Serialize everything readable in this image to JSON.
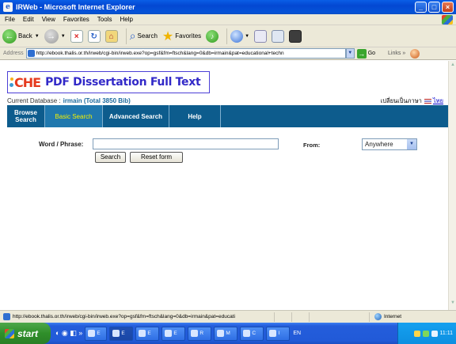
{
  "window": {
    "title": "IRWeb - Microsoft Internet Explorer",
    "minimize_glyph": "_",
    "maximize_glyph": "□",
    "close_glyph": "×"
  },
  "menu": [
    "File",
    "Edit",
    "View",
    "Favorites",
    "Tools",
    "Help"
  ],
  "toolbar": {
    "back_label": "Back",
    "search_label": "Search",
    "favorites_label": "Favorites"
  },
  "address": {
    "label": "Address",
    "url": "http://ebook.thalis.or.th/irweb/cgi-bin/irweb.exe?op=gsf&fm=ftsch&lang=0&db=irmain&pat=educational+techn",
    "go_label": "Go",
    "links_label": "Links"
  },
  "page": {
    "logo_mark": "CHE",
    "logo_title": "PDF Dissertation Full Text",
    "db_label": "Current Database :",
    "db_name": "irmain (Total 3850 Bib)",
    "lang_switch_text": "เปลี่ยนเป็นภาษา",
    "lang_link": "ไทย",
    "nav": [
      {
        "label": "Browse Search",
        "active": false
      },
      {
        "label": "Basic Search",
        "active": true
      },
      {
        "label": "Advanced Search",
        "active": false
      },
      {
        "label": "Help",
        "active": false
      }
    ],
    "form": {
      "word_label": "Word / Phrase:",
      "word_value": "",
      "from_label": "From:",
      "from_selected": "Anywhere",
      "search_button": "Search",
      "reset_button": "Reset form"
    }
  },
  "status": {
    "url": "http://ebook.thalis.or.th/irweb/cgi-bin/irweb.exe?op=gsf&fm=ftsch&lang=0&db=irmain&pat=educati",
    "zone": "Internet"
  },
  "taskbar": {
    "start_label": "start",
    "tasks": [
      "E",
      "E",
      "E",
      "E",
      "R",
      "M",
      "C",
      "I"
    ],
    "lang": "EN",
    "clock": "11:11"
  }
}
